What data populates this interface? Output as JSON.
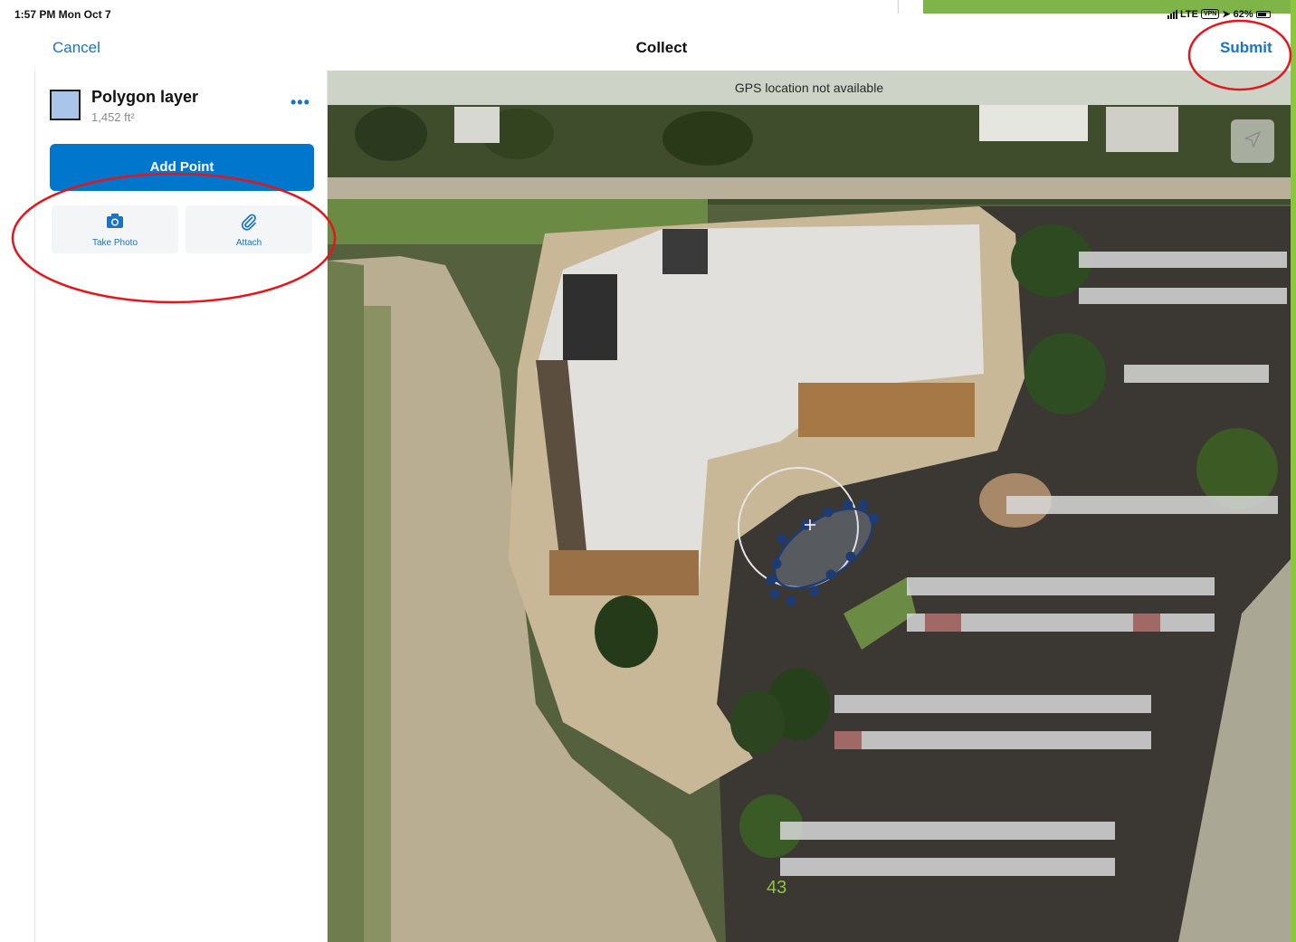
{
  "status_bar": {
    "time": "1:57 PM  Mon Oct 7",
    "network": "LTE",
    "vpn": "VPN",
    "battery": "62%"
  },
  "nav": {
    "cancel_label": "Cancel",
    "title": "Collect",
    "submit_label": "Submit"
  },
  "layer": {
    "name": "Polygon layer",
    "area": "1,452 ft²",
    "swatch_color": "#a9c6ea",
    "more_label": "•••"
  },
  "actions": {
    "add_point_label": "Add Point",
    "take_photo_label": "Take Photo",
    "attach_label": "Attach"
  },
  "map": {
    "gps_banner": "GPS location not available",
    "locate_icon": "location-arrow-icon",
    "basemap": "satellite imagery"
  },
  "annotations": {
    "color": "#e3161b"
  },
  "slide_number": "43",
  "colors": {
    "accent_blue": "#1a73c9",
    "primary_button": "#0077cc",
    "slide_accent": "#8cc63f"
  }
}
